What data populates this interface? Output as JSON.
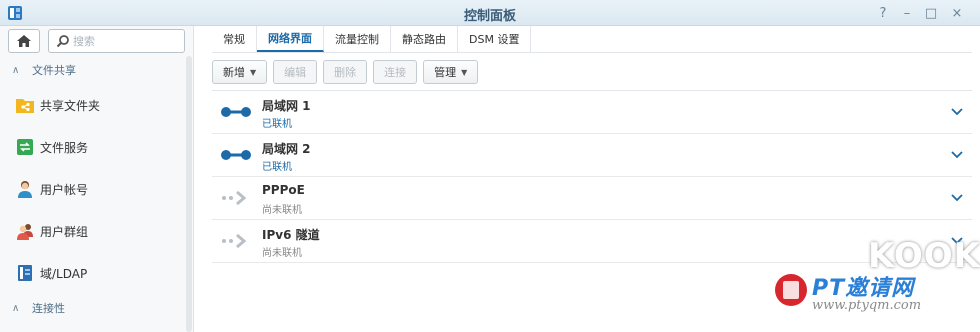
{
  "window": {
    "title": "控制面板",
    "help_icon": "?",
    "minimize_icon": "–",
    "maximize_icon": "□",
    "close_icon": "×"
  },
  "sidebar": {
    "search_placeholder": "搜索",
    "sections": [
      {
        "label": "文件共享",
        "expanded": true
      },
      {
        "label": "连接性",
        "expanded": true
      }
    ],
    "items": [
      {
        "label": "共享文件夹",
        "icon": "shared-folder-icon"
      },
      {
        "label": "文件服务",
        "icon": "file-services-icon"
      },
      {
        "label": "用户帐号",
        "icon": "user-icon"
      },
      {
        "label": "用户群组",
        "icon": "group-icon"
      },
      {
        "label": "域/LDAP",
        "icon": "domain-ldap-icon"
      }
    ]
  },
  "tabs": [
    {
      "label": "常规",
      "active": false
    },
    {
      "label": "网络界面",
      "active": true
    },
    {
      "label": "流量控制",
      "active": false
    },
    {
      "label": "静态路由",
      "active": false
    },
    {
      "label": "DSM 设置",
      "active": false
    }
  ],
  "toolbar": {
    "create": "新增",
    "edit": "编辑",
    "delete": "删除",
    "connect": "连接",
    "manage": "管理"
  },
  "interfaces": [
    {
      "name": "局域网 1",
      "status": "已联机",
      "connected": true
    },
    {
      "name": "局域网 2",
      "status": "已联机",
      "connected": true
    },
    {
      "name": "PPPoE",
      "status": "尚未联机",
      "connected": false
    },
    {
      "name": "IPv6 隧道",
      "status": "尚未联机",
      "connected": false
    }
  ],
  "watermark": {
    "brand": "KOOK",
    "site_name": "PT邀请网",
    "url": "www.ptyqm.com"
  },
  "colors": {
    "accent": "#1d6aa8",
    "connected_icon": "#1d6aa8",
    "disconnected_icon": "#b9bfc4"
  }
}
